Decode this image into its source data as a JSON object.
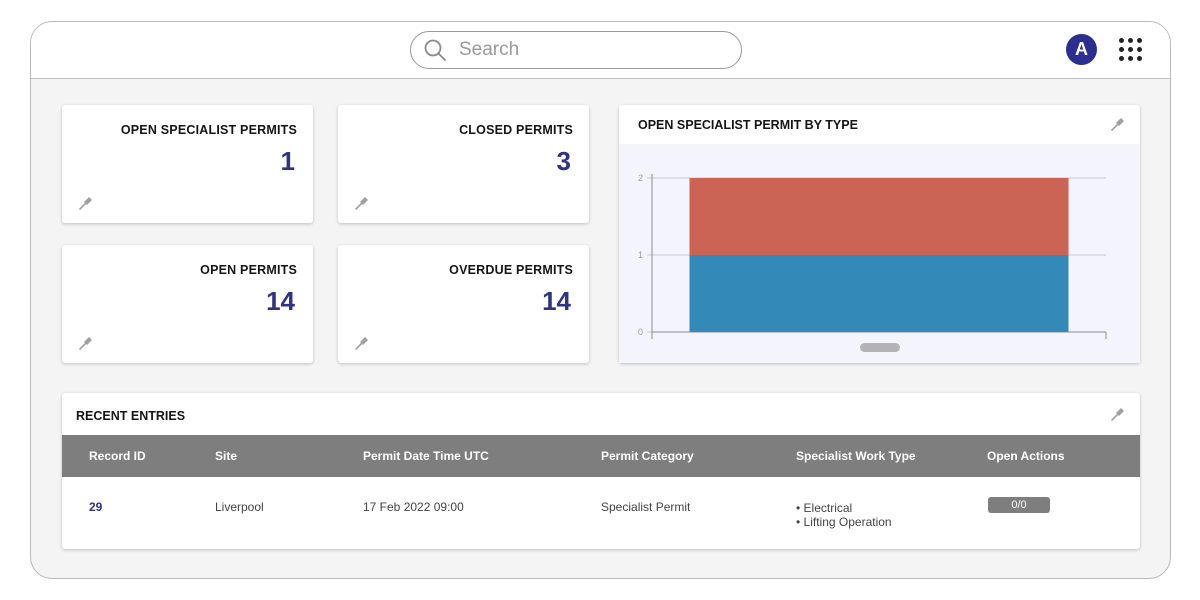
{
  "header": {
    "search": {
      "placeholder": "Search",
      "value": ""
    },
    "avatar_initial": "A",
    "icons": {
      "search": "search-icon",
      "apps": "apps-grid-icon"
    },
    "accent_color": "#2c2f8f"
  },
  "kpis": [
    {
      "title": "OPEN SPECIALIST PERMITS",
      "value": "1"
    },
    {
      "title": "CLOSED PERMITS",
      "value": "3"
    },
    {
      "title": "OPEN PERMITS",
      "value": "14"
    },
    {
      "title": "OVERDUE PERMITS",
      "value": "14"
    }
  ],
  "chart": {
    "title": "OPEN SPECIALIST PERMIT BY TYPE"
  },
  "chart_data": {
    "type": "bar",
    "stacked": true,
    "categories": [
      ""
    ],
    "series": [
      {
        "values": [
          1
        ],
        "color": "#3389b7"
      },
      {
        "values": [
          1
        ],
        "color": "#cc6455"
      }
    ],
    "yticks": [
      "0",
      "1",
      "2"
    ],
    "ylim": [
      0,
      2
    ],
    "grid": true
  },
  "recent": {
    "title": "RECENT ENTRIES",
    "columns": [
      "Record ID",
      "Site",
      "Permit Date Time UTC",
      "Permit Category",
      "Specialist Work Type",
      "Open Actions"
    ],
    "rows": [
      {
        "record_id": "29",
        "site": "Liverpool",
        "datetime": "17 Feb 2022 09:00",
        "category": "Specialist Permit",
        "work_types": [
          "• Electrical",
          "• Lifting Operation"
        ],
        "open_actions": "0/0"
      }
    ]
  }
}
